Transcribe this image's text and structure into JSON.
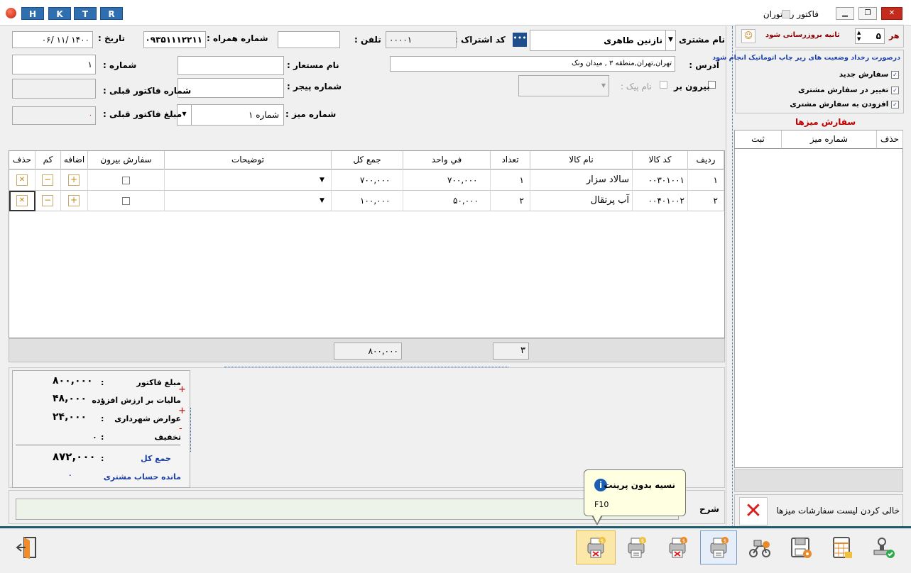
{
  "window": {
    "title": "فاکتور رستوران",
    "quick_buttons": [
      "H",
      "K",
      "T",
      "R"
    ]
  },
  "form": {
    "customer_name_label": "نام مشتری :",
    "customer_name_value": "نازنین طاهری",
    "subscription_code_label": "کد اشتراک :",
    "subscription_code_value": "۰۰۰۰۱",
    "phone_label": "تلفن :",
    "phone_value": "",
    "mobile_label": "شماره همراه :",
    "mobile_value": "۰۹۳۵۱۱۱۲۲۱۱",
    "date_label": "تاریخ :",
    "date_value": "۱۴۰۰ /۱۱ /۰۶",
    "address_label": "آدرس :",
    "address_value": "تهران,تهران,منطقه ۳ , میدان ونک",
    "alias_label": "نام مستعار :",
    "alias_value": "",
    "number_label": "شماره :",
    "number_value": "۱",
    "takeout_label": "بیرون بر",
    "courier_label": "نام پیک :",
    "pager_label": "شماره پیجر :",
    "pager_value": "",
    "prev_invoice_label": "شماره فاکتور قبلی :",
    "prev_invoice_value": "",
    "table_no_label": "شماره میز :",
    "table_no_value": "شماره ۱",
    "prev_amount_label": "مبلغ فاکتور قبلی :",
    "prev_amount_value": "۰"
  },
  "items_grid": {
    "headers": {
      "row": "ردیف",
      "code": "کد کالا",
      "name": "نام کالا",
      "qty": "تعداد",
      "unit": "في واحد",
      "total": "جمع کل",
      "desc": "توضیحات",
      "takeout": "سفارش بیرون",
      "add": "اضافه",
      "less": "کم",
      "delete": "حذف"
    },
    "rows": [
      {
        "row": "۱",
        "code": "۰۰۳۰۱۰۰۱",
        "name": "سالاد سزار",
        "qty": "۱",
        "unit": "۷۰۰,۰۰۰",
        "total": "۷۰۰,۰۰۰",
        "desc": ""
      },
      {
        "row": "۲",
        "code": "۰۰۴۰۱۰۰۲",
        "name": "آب پرتقال",
        "qty": "۲",
        "unit": "۵۰,۰۰۰",
        "total": "۱۰۰,۰۰۰",
        "desc": ""
      }
    ],
    "footer_qty": "۳",
    "footer_total": "۸۰۰,۰۰۰"
  },
  "summary": {
    "invoice_amount_label": "مبلغ فاکتور",
    "invoice_amount": "۸۰۰,۰۰۰",
    "vat_label": "مالیات بر ارزش افزوده",
    "vat": "۴۸,۰۰۰",
    "municipal_label": "عوارض شهرداری",
    "municipal": "۲۴,۰۰۰",
    "discount_label": "تخفیف",
    "discount": "۰",
    "grand_total_label": "جمع کل",
    "grand_total": "۸۷۲,۰۰۰",
    "balance_label": "مانده حساب مشتری",
    "balance": "۰"
  },
  "notes": {
    "label": "شرح",
    "value": ""
  },
  "tooltip": {
    "title": "نسیه بدون پرینت",
    "shortcut": "F10"
  },
  "right_panel": {
    "every_label": "هر",
    "interval_value": "۵",
    "refresh_label": "ثانیه بروزرسانی شود",
    "auto_print_title": "درصورت رخداد وضعیت های زیر چاپ اتوماتیک انجام شود",
    "options": [
      "سفارش جدید",
      "تغییر در سفارش مشتری",
      "افزودن به سفارش مشتری"
    ],
    "tables_title": "سفارش میزها",
    "tables_headers": {
      "delete": "حذف",
      "table_no": "شماره میز",
      "register": "ثبت"
    },
    "clear_label": "خالی کردن لیست سفارشات میزها"
  },
  "colors": {
    "accent_blue": "#2f6fb0",
    "brand_red": "#c00000",
    "tooltip_bg": "#ffffe1"
  }
}
